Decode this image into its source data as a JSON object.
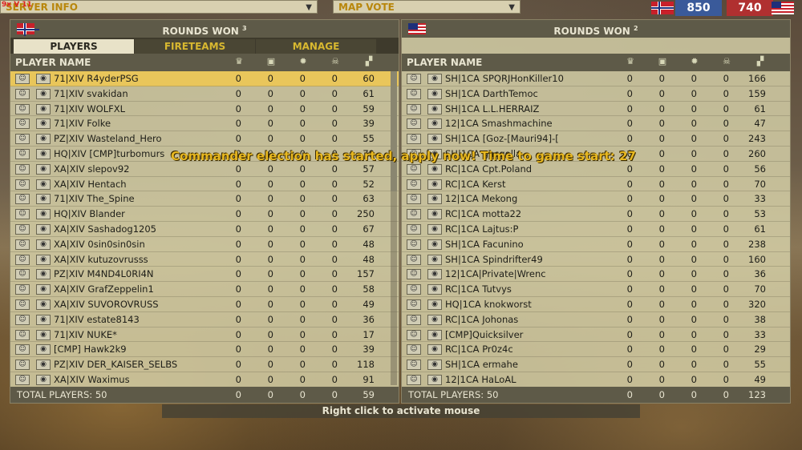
{
  "topbar": {
    "logo_text": "9x V 11",
    "server_info_label": "SERVER INFO",
    "map_vote_label": "MAP VOTE",
    "score_team1": "850",
    "score_team2": "740"
  },
  "left": {
    "rounds_won_label": "ROUNDS WON",
    "rounds_won_value": "3",
    "tabs": [
      "PLAYERS",
      "FIRETEAMS",
      "MANAGE"
    ],
    "col_player_name": "PLAYER NAME",
    "players": [
      {
        "name": "71|XIV R4yderPSG",
        "v": [
          "0",
          "0",
          "0",
          "0",
          "60"
        ]
      },
      {
        "name": "71|XIV svakidan",
        "v": [
          "0",
          "0",
          "0",
          "0",
          "61"
        ]
      },
      {
        "name": "71|XIV WOLFXL",
        "v": [
          "0",
          "0",
          "0",
          "0",
          "59"
        ]
      },
      {
        "name": "71|XIV Folke",
        "v": [
          "0",
          "0",
          "0",
          "0",
          "39"
        ]
      },
      {
        "name": "PZ|XIV Wasteland_Hero",
        "v": [
          "0",
          "0",
          "0",
          "0",
          "55"
        ]
      },
      {
        "name": "HQ|XIV [CMP]turbomurs",
        "v": [
          "0",
          "0",
          "0",
          "0",
          "79"
        ]
      },
      {
        "name": "XA|XIV slepov92",
        "v": [
          "0",
          "0",
          "0",
          "0",
          "57"
        ]
      },
      {
        "name": "XA|XIV Hentach",
        "v": [
          "0",
          "0",
          "0",
          "0",
          "52"
        ]
      },
      {
        "name": "71|XIV The_Spine",
        "v": [
          "0",
          "0",
          "0",
          "0",
          "63"
        ]
      },
      {
        "name": "HQ|XIV Blander",
        "v": [
          "0",
          "0",
          "0",
          "0",
          "250"
        ]
      },
      {
        "name": "XA|XIV Sashadog1205",
        "v": [
          "0",
          "0",
          "0",
          "0",
          "67"
        ]
      },
      {
        "name": "XA|XIV 0sin0sin0sin",
        "v": [
          "0",
          "0",
          "0",
          "0",
          "48"
        ]
      },
      {
        "name": "XA|XIV kutuzovrusss",
        "v": [
          "0",
          "0",
          "0",
          "0",
          "48"
        ]
      },
      {
        "name": "PZ|XIV M4ND4L0RI4N",
        "v": [
          "0",
          "0",
          "0",
          "0",
          "157"
        ]
      },
      {
        "name": "XA|XIV GrafZeppelin1",
        "v": [
          "0",
          "0",
          "0",
          "0",
          "58"
        ]
      },
      {
        "name": "XA|XIV SUVOROVRUSS",
        "v": [
          "0",
          "0",
          "0",
          "0",
          "49"
        ]
      },
      {
        "name": "71|XIV estate8143",
        "v": [
          "0",
          "0",
          "0",
          "0",
          "36"
        ]
      },
      {
        "name": "71|XIV NUKE*",
        "v": [
          "0",
          "0",
          "0",
          "0",
          "17"
        ]
      },
      {
        "name": "[CMP] Hawk2k9",
        "v": [
          "0",
          "0",
          "0",
          "0",
          "39"
        ]
      },
      {
        "name": "PZ|XIV DER_KAISER_SELBS",
        "v": [
          "0",
          "0",
          "0",
          "0",
          "118"
        ]
      },
      {
        "name": "XA|XIV Waximus",
        "v": [
          "0",
          "0",
          "0",
          "0",
          "91"
        ]
      }
    ],
    "total_label": "TOTAL PLAYERS: 50",
    "totals": [
      "0",
      "0",
      "0",
      "0",
      "59"
    ]
  },
  "right": {
    "rounds_won_label": "ROUNDS WON",
    "rounds_won_value": "2",
    "col_player_name": "PLAYER NAME",
    "players": [
      {
        "name": "SH|1CA SPQRJHonKiller10",
        "v": [
          "0",
          "0",
          "0",
          "0",
          "166"
        ]
      },
      {
        "name": "SH|1CA DarthTemoc",
        "v": [
          "0",
          "0",
          "0",
          "0",
          "159"
        ]
      },
      {
        "name": "SH|1CA L.L.HERRAIZ",
        "v": [
          "0",
          "0",
          "0",
          "0",
          "61"
        ]
      },
      {
        "name": "12|1CA Smashmachine",
        "v": [
          "0",
          "0",
          "0",
          "0",
          "47"
        ]
      },
      {
        "name": "SH|1CA [Goz-[Mauri94]-[",
        "v": [
          "0",
          "0",
          "0",
          "0",
          "243"
        ]
      },
      {
        "name": "SH|1CA gacgolla",
        "v": [
          "0",
          "0",
          "0",
          "0",
          "260"
        ]
      },
      {
        "name": "RC|1CA Cpt.Poland",
        "v": [
          "0",
          "0",
          "0",
          "0",
          "56"
        ]
      },
      {
        "name": "RC|1CA Kerst",
        "v": [
          "0",
          "0",
          "0",
          "0",
          "70"
        ]
      },
      {
        "name": "12|1CA Mekong",
        "v": [
          "0",
          "0",
          "0",
          "0",
          "33"
        ]
      },
      {
        "name": "RC|1CA motta22",
        "v": [
          "0",
          "0",
          "0",
          "0",
          "53"
        ]
      },
      {
        "name": "RC|1CA Lajtus:P",
        "v": [
          "0",
          "0",
          "0",
          "0",
          "61"
        ]
      },
      {
        "name": "SH|1CA Facunino",
        "v": [
          "0",
          "0",
          "0",
          "0",
          "238"
        ]
      },
      {
        "name": "SH|1CA Spindrifter49",
        "v": [
          "0",
          "0",
          "0",
          "0",
          "160"
        ]
      },
      {
        "name": "12|1CA|Private|Wrenc",
        "v": [
          "0",
          "0",
          "0",
          "0",
          "36"
        ]
      },
      {
        "name": "RC|1CA Tutvys",
        "v": [
          "0",
          "0",
          "0",
          "0",
          "70"
        ]
      },
      {
        "name": "HQ|1CA knokworst",
        "v": [
          "0",
          "0",
          "0",
          "0",
          "320"
        ]
      },
      {
        "name": "RC|1CA Johonas",
        "v": [
          "0",
          "0",
          "0",
          "0",
          "38"
        ]
      },
      {
        "name": "[CMP]Quicksilver",
        "v": [
          "0",
          "0",
          "0",
          "0",
          "33"
        ]
      },
      {
        "name": "RC|1CA Pr0z4c",
        "v": [
          "0",
          "0",
          "0",
          "0",
          "29"
        ]
      },
      {
        "name": "SH|1CA ermahe",
        "v": [
          "0",
          "0",
          "0",
          "0",
          "55"
        ]
      },
      {
        "name": "12|1CA HaLoAL",
        "v": [
          "0",
          "0",
          "0",
          "0",
          "49"
        ]
      }
    ],
    "total_label": "TOTAL PLAYERS: 50",
    "totals": [
      "0",
      "0",
      "0",
      "0",
      "123"
    ]
  },
  "announcement": "Commander election has started, apply now! Time to game start: 27",
  "hint": "Right click to activate mouse",
  "icons": [
    "trophy-icon",
    "kills-icon",
    "assist-icon",
    "deaths-icon",
    "score-icon",
    "squad-icon",
    "voice-icon"
  ]
}
